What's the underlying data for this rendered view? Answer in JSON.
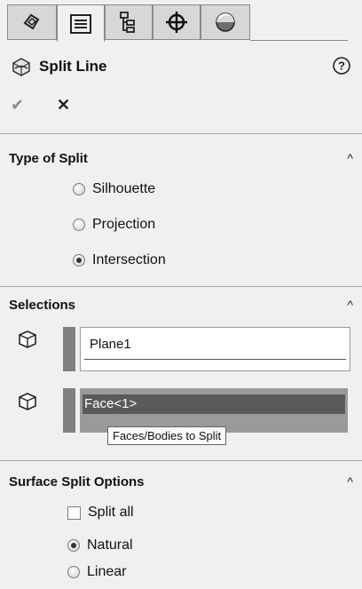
{
  "tabs": [
    {
      "icon": "feature-manager-icon"
    },
    {
      "icon": "property-manager-icon"
    },
    {
      "icon": "configuration-manager-icon"
    },
    {
      "icon": "dimxpert-manager-icon"
    },
    {
      "icon": "display-manager-icon"
    }
  ],
  "header": {
    "title": "Split Line",
    "help_glyph": "?"
  },
  "actions": {
    "ok_glyph": "✔",
    "cancel_glyph": "✕"
  },
  "type_of_split": {
    "title": "Type of Split",
    "collapse_glyph": "^",
    "options": [
      {
        "label": "Silhouette",
        "checked": false
      },
      {
        "label": "Projection",
        "checked": false
      },
      {
        "label": "Intersection",
        "checked": true
      }
    ]
  },
  "selections": {
    "title": "Selections",
    "collapse_glyph": "^",
    "list1_item": "Plane1",
    "list2_item": "Face<1>",
    "tooltip": "Faces/Bodies to Split"
  },
  "surface_split_options": {
    "title": "Surface Split Options",
    "collapse_glyph": "^",
    "split_all": "Split all",
    "options": [
      {
        "label": "Natural",
        "checked": true
      },
      {
        "label": "Linear",
        "checked": false
      }
    ]
  },
  "colors": {
    "panel_bg": "#f0f0f0",
    "selbar": "#808080",
    "highlight": "#5a5a5a"
  }
}
